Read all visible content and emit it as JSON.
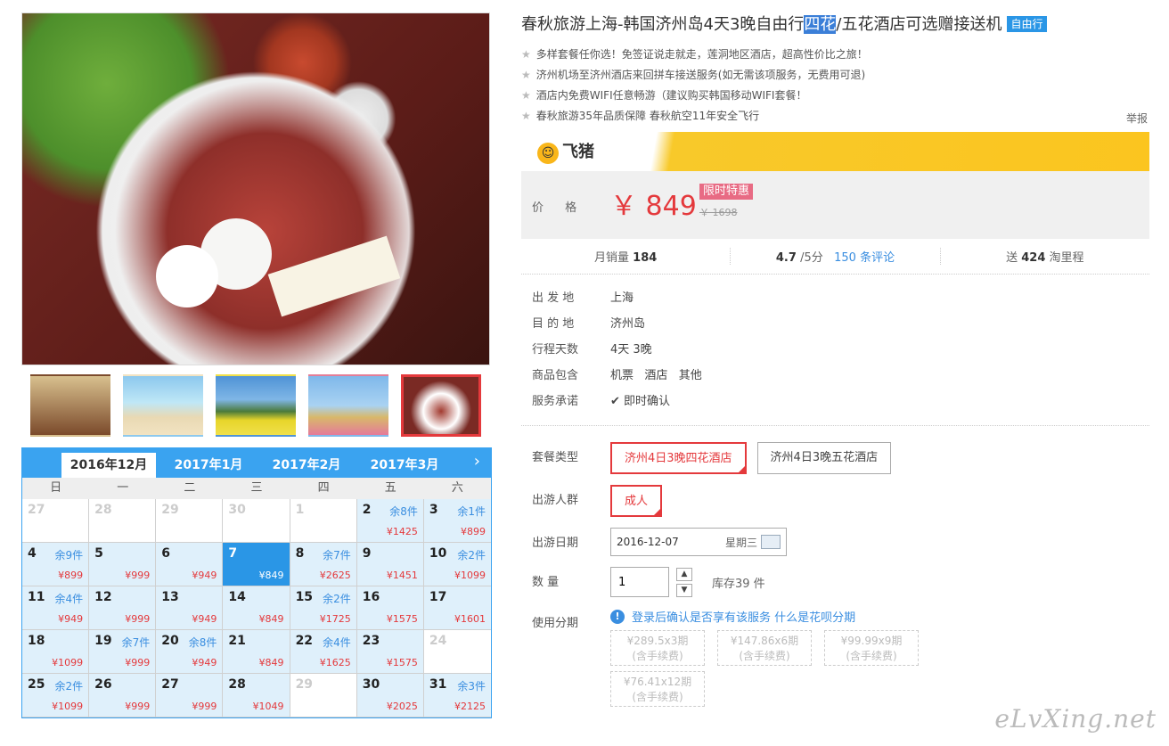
{
  "product": {
    "title_pre": "春秋旅游上海-韩国济州岛4天3晚自由行",
    "title_hl": "四花",
    "title_post": "/五花酒店可选赠接送机",
    "tag": "自由行",
    "features": [
      "多样套餐任你选！免签证说走就走，莲洞地区酒店，超高性价比之旅！",
      "济州机场至济州酒店来回拼车接送服务(如无需该项服务，无费用可退)",
      "酒店内免费WIFI任意畅游（建议购买韩国移动WIFI套餐！",
      "春秋旅游35年品质保障 春秋航空11年安全飞行"
    ],
    "report": "举报",
    "brand": "飞猪",
    "price_label": "价 格",
    "price": "￥ 849",
    "badge": "限时特惠",
    "old_price": "￥ 1698",
    "stats": {
      "sales_label": "月销量",
      "sales": "184",
      "rating": "4.7",
      "rating_suffix": "/5分",
      "reviews": "150 条评论",
      "mileage_pre": "送",
      "mileage": "424",
      "mileage_suf": "淘里程"
    },
    "info": [
      {
        "k": "出 发 地",
        "v": "上海"
      },
      {
        "k": "目 的 地",
        "v": "济州岛"
      },
      {
        "k": "行程天数",
        "v": "4天 3晚"
      },
      {
        "k": "商品包含",
        "v": "机票   酒店   其他"
      },
      {
        "k": "服务承诺",
        "v": "即时确认"
      }
    ],
    "options": {
      "package_label": "套餐类型",
      "package_a": "济州4日3晚四花酒店",
      "package_b": "济州4日3晚五花酒店",
      "people_label": "出游人群",
      "people": "成人",
      "date_label": "出游日期",
      "date": "2016-12-07",
      "weekday": "星期三",
      "qty_label": "数 量",
      "qty": "1",
      "stock": "库存39 件",
      "inst_label": "使用分期",
      "inst_tip": "登录后确认是否享有该服务",
      "inst_link": "什么是花呗分期",
      "plans": [
        {
          "a": "¥289.5x3期",
          "b": "(含手续费)"
        },
        {
          "a": "¥147.86x6期",
          "b": "(含手续费)"
        },
        {
          "a": "¥99.99x9期",
          "b": "(含手续费)"
        },
        {
          "a": "¥76.41x12期",
          "b": "(含手续费)"
        }
      ]
    }
  },
  "calendar": {
    "months": [
      "2016年12月",
      "2017年1月",
      "2017年2月",
      "2017年3月"
    ],
    "weekdays": [
      "日",
      "一",
      "二",
      "三",
      "四",
      "五",
      "六"
    ],
    "days": [
      {
        "n": "27",
        "s": "",
        "p": "",
        "t": "blank"
      },
      {
        "n": "28",
        "s": "",
        "p": "",
        "t": "blank"
      },
      {
        "n": "29",
        "s": "",
        "p": "",
        "t": "blank"
      },
      {
        "n": "30",
        "s": "",
        "p": "",
        "t": "blank"
      },
      {
        "n": "1",
        "s": "",
        "p": "",
        "t": "blank"
      },
      {
        "n": "2",
        "s": "余8件",
        "p": "¥1425",
        "t": ""
      },
      {
        "n": "3",
        "s": "余1件",
        "p": "¥899",
        "t": ""
      },
      {
        "n": "4",
        "s": "余9件",
        "p": "¥899",
        "t": ""
      },
      {
        "n": "5",
        "s": "",
        "p": "¥999",
        "t": ""
      },
      {
        "n": "6",
        "s": "",
        "p": "¥949",
        "t": ""
      },
      {
        "n": "7",
        "s": "",
        "p": "¥849",
        "t": "sel"
      },
      {
        "n": "8",
        "s": "余7件",
        "p": "¥2625",
        "t": ""
      },
      {
        "n": "9",
        "s": "",
        "p": "¥1451",
        "t": ""
      },
      {
        "n": "10",
        "s": "余2件",
        "p": "¥1099",
        "t": ""
      },
      {
        "n": "11",
        "s": "余4件",
        "p": "¥949",
        "t": ""
      },
      {
        "n": "12",
        "s": "",
        "p": "¥999",
        "t": ""
      },
      {
        "n": "13",
        "s": "",
        "p": "¥949",
        "t": ""
      },
      {
        "n": "14",
        "s": "",
        "p": "¥849",
        "t": ""
      },
      {
        "n": "15",
        "s": "余2件",
        "p": "¥1725",
        "t": ""
      },
      {
        "n": "16",
        "s": "",
        "p": "¥1575",
        "t": ""
      },
      {
        "n": "17",
        "s": "",
        "p": "¥1601",
        "t": ""
      },
      {
        "n": "18",
        "s": "",
        "p": "¥1099",
        "t": ""
      },
      {
        "n": "19",
        "s": "余7件",
        "p": "¥999",
        "t": ""
      },
      {
        "n": "20",
        "s": "余8件",
        "p": "¥949",
        "t": ""
      },
      {
        "n": "21",
        "s": "",
        "p": "¥849",
        "t": ""
      },
      {
        "n": "22",
        "s": "余4件",
        "p": "¥1625",
        "t": ""
      },
      {
        "n": "23",
        "s": "",
        "p": "¥1575",
        "t": ""
      },
      {
        "n": "24",
        "s": "",
        "p": "",
        "t": "blank"
      },
      {
        "n": "25",
        "s": "余2件",
        "p": "¥1099",
        "t": ""
      },
      {
        "n": "26",
        "s": "",
        "p": "¥999",
        "t": ""
      },
      {
        "n": "27",
        "s": "",
        "p": "¥999",
        "t": ""
      },
      {
        "n": "28",
        "s": "",
        "p": "¥1049",
        "t": ""
      },
      {
        "n": "29",
        "s": "",
        "p": "",
        "t": "blank"
      },
      {
        "n": "30",
        "s": "",
        "p": "¥2025",
        "t": ""
      },
      {
        "n": "31",
        "s": "余3件",
        "p": "¥2125",
        "t": ""
      }
    ]
  },
  "watermark": "eLvXing.net"
}
